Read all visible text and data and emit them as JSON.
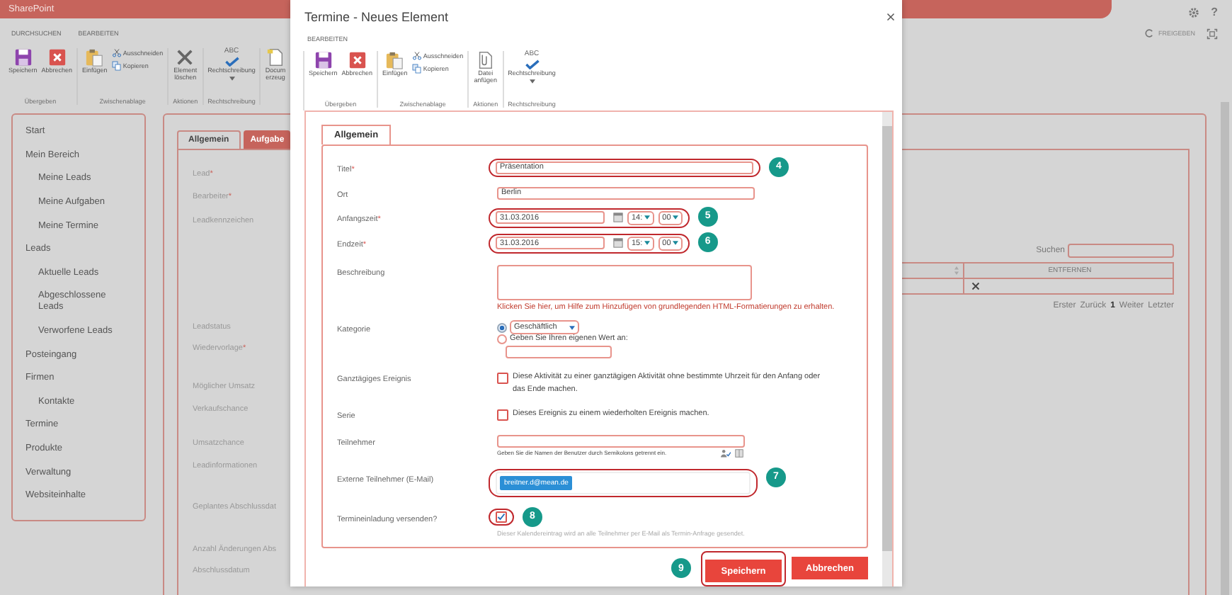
{
  "page": {
    "app_title": "SharePoint",
    "help_label": "?",
    "share_label": "FREIGEBEN",
    "ribbon": {
      "tabs": [
        "DURCHSUCHEN",
        "BEARBEITEN"
      ],
      "groups": [
        {
          "label": "Übergeben",
          "buttons": [
            {
              "kind": "save",
              "label": "Speichern"
            },
            {
              "kind": "cancel",
              "label": "Abbrechen"
            }
          ]
        },
        {
          "label": "Zwischenablage",
          "buttons": [
            {
              "kind": "paste",
              "label": "Einfügen"
            },
            {
              "kind": "cut",
              "label": "Ausschneiden"
            },
            {
              "kind": "copy",
              "label": "Kopieren"
            }
          ]
        },
        {
          "label": "Aktionen",
          "buttons": [
            {
              "kind": "delete",
              "label": "Element\nlöschen"
            }
          ]
        },
        {
          "label": "Rechtschreibung",
          "buttons": [
            {
              "kind": "spelling",
              "label": "Rechtschreibung",
              "icon_text": "ABC"
            }
          ]
        },
        {
          "buttons": [
            {
              "kind": "document",
              "label": "Docum\nerzeug"
            }
          ]
        }
      ]
    },
    "sidebar": {
      "items": [
        {
          "label": "Start"
        },
        {
          "label": "Mein Bereich",
          "children": [
            {
              "label": "Meine Leads"
            },
            {
              "label": "Meine Aufgaben"
            },
            {
              "label": "Meine Termine"
            }
          ]
        },
        {
          "label": "Leads",
          "children": [
            {
              "label": "Aktuelle Leads"
            },
            {
              "label": "Abgeschlossene Leads"
            },
            {
              "label": "Verworfene Leads"
            }
          ]
        },
        {
          "label": "Posteingang"
        },
        {
          "label": "Firmen",
          "children": [
            {
              "label": "Kontakte"
            }
          ]
        },
        {
          "label": "Termine"
        },
        {
          "label": "Produkte"
        },
        {
          "label": "Verwaltung"
        },
        {
          "label": "Websiteinhalte"
        }
      ]
    },
    "tabs": [
      {
        "label": "Allgemein",
        "selected": true
      },
      {
        "label": "Aufgabe",
        "selected": false
      }
    ],
    "fields": [
      {
        "label": "Lead",
        "marker": "*"
      },
      {
        "label": "Bearbeiter",
        "marker": "*"
      },
      {
        "label": "Leadkennzeichen"
      },
      {
        "label": "Leadstatus"
      },
      {
        "label": "Wiedervorlage",
        "marker": "*"
      },
      {
        "label": "Möglicher Umsatz"
      },
      {
        "label": "Verkaufschance"
      },
      {
        "label": "Umsatzchance"
      },
      {
        "label": "Leadinformationen"
      },
      {
        "label": "Geplantes Abschlussdat"
      },
      {
        "label": "Anzahl Änderungen Abs"
      },
      {
        "label": "Abschlussdatum"
      }
    ],
    "search_label": "Suchen",
    "table": {
      "columns": [
        "ENTFERNEN"
      ]
    },
    "pager": [
      {
        "label": "Erster",
        "selected": false
      },
      {
        "label": "Zurück",
        "selected": false
      },
      {
        "label": "1",
        "selected": true
      },
      {
        "label": "Weiter",
        "selected": false
      },
      {
        "label": "Letzter",
        "selected": false
      }
    ]
  },
  "dialog": {
    "title": "Termine - Neues Element",
    "ribbon": {
      "tabs": [
        "BEARBEITEN"
      ],
      "groups": [
        {
          "label": "Übergeben",
          "buttons": [
            {
              "kind": "save",
              "label": "Speichern"
            },
            {
              "kind": "cancel",
              "label": "Abbrechen"
            }
          ]
        },
        {
          "label": "Zwischenablage",
          "buttons": [
            {
              "kind": "paste",
              "label": "Einfügen"
            },
            {
              "kind": "cut",
              "label": "Ausschneiden"
            },
            {
              "kind": "copy",
              "label": "Kopieren"
            }
          ]
        },
        {
          "label": "Aktionen",
          "buttons": [
            {
              "kind": "attach",
              "label": "Datei\nanfügen"
            }
          ]
        },
        {
          "label": "Rechtschreibung",
          "buttons": [
            {
              "kind": "spelling",
              "label": "Rechtschreibung",
              "icon_text": "ABC"
            }
          ]
        }
      ]
    },
    "tabs": [
      {
        "label": "Allgemein",
        "selected": true
      }
    ],
    "fields": [
      {
        "kind": "text",
        "label": "Titel",
        "marker": "*",
        "value": "Präsentation",
        "highlighted": true,
        "callout": "4"
      },
      {
        "kind": "text",
        "label": "Ort",
        "value": "Berlin",
        "highlighted": false
      },
      {
        "kind": "datetime",
        "label": "Anfangszeit",
        "marker": "*",
        "date": "31.03.2016",
        "hour": "14:",
        "minute": "00",
        "highlighted": true,
        "callout": "5"
      },
      {
        "kind": "datetime",
        "label": "Endzeit",
        "marker": "*",
        "date": "31.03.2016",
        "hour": "15:",
        "minute": "00",
        "highlighted": true,
        "callout": "6"
      },
      {
        "kind": "textarea",
        "label": "Beschreibung",
        "help": "Klicken Sie hier, um Hilfe zum Hinzufügen von grundlegenden HTML-Formatierungen zu erhalten."
      },
      {
        "kind": "choice",
        "label": "Kategorie",
        "options": [
          {
            "kind": "select",
            "value": "Geschäftlich",
            "selected": true
          },
          {
            "kind": "custom",
            "label": "Geben Sie Ihren eigenen Wert an:",
            "selected": false
          }
        ]
      },
      {
        "kind": "checkbox",
        "label": "Ganztägiges Ereignis",
        "text": "Diese Aktivität zu einer ganztägigen Aktivität ohne bestimmte Uhrzeit für den Anfang oder das Ende machen.",
        "checked": false,
        "highlighted": false
      },
      {
        "kind": "checkbox",
        "label": "Serie",
        "text": "Dieses Ereignis zu einem wiederholten Ereignis machen.",
        "checked": false,
        "highlighted": false
      },
      {
        "kind": "people",
        "label": "Teilnehmer",
        "hint": "Geben Sie die Namen der Benutzer durch Semikolons getrennt ein."
      },
      {
        "kind": "email",
        "label": "Externe Teilnehmer (E-Mail)",
        "tokens": [
          "breitner.d@mean.de"
        ],
        "highlighted": true,
        "callout": "7"
      },
      {
        "kind": "checkbox",
        "label": "Termineinladung versenden?",
        "checked": true,
        "highlighted": true,
        "callout": "8",
        "hint": "Dieser Kalendereintrag wird an alle Teilnehmer per E-Mail als Termin-Anfrage gesendet."
      }
    ],
    "buttons": [
      {
        "label": "Speichern",
        "highlighted": true,
        "callout": "9"
      },
      {
        "label": "Abbrechen",
        "highlighted": false
      }
    ]
  }
}
